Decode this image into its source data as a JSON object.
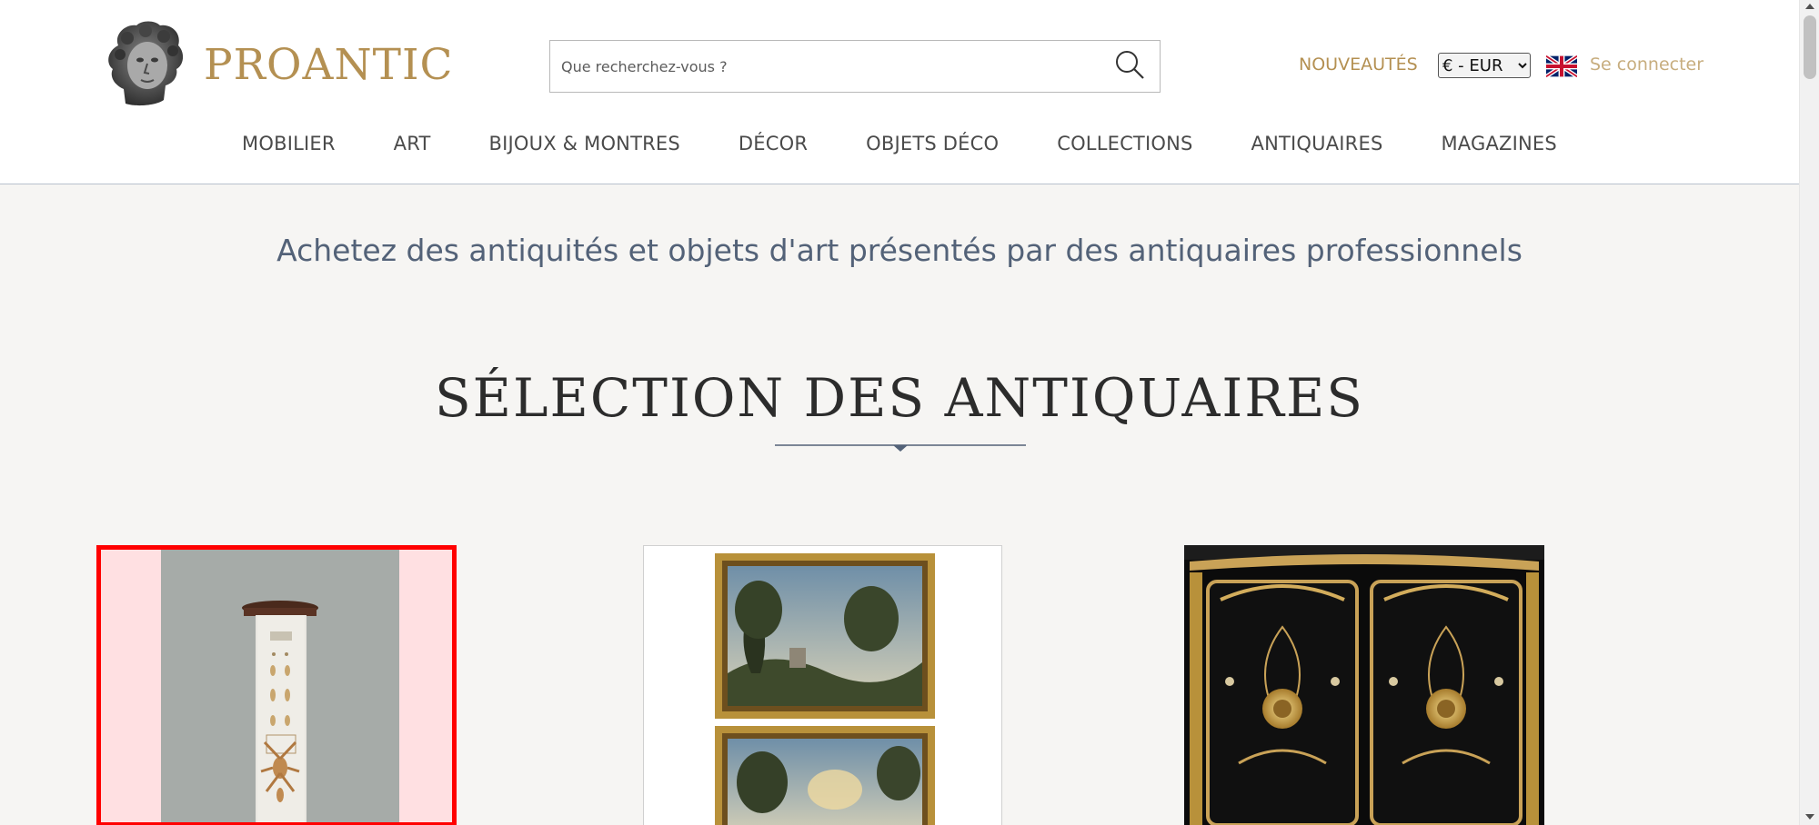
{
  "brand": {
    "name": "PROANTIC",
    "color": "#b49052"
  },
  "search": {
    "placeholder": "Que recherchez-vous ?",
    "icon": "search-icon"
  },
  "header_links": {
    "news": "NOUVEAUTÉS",
    "login": "Se connecter",
    "news_color": "#b49052",
    "login_color": "#c7ad7e"
  },
  "currency": {
    "selected": "€ - EUR"
  },
  "language": {
    "icon": "uk-flag-icon"
  },
  "nav": {
    "items": [
      {
        "label": "MOBILIER"
      },
      {
        "label": "ART"
      },
      {
        "label": "BIJOUX & MONTRES"
      },
      {
        "label": "DÉCOR"
      },
      {
        "label": "OBJETS DÉCO"
      },
      {
        "label": "COLLECTIONS"
      },
      {
        "label": "ANTIQUAIRES"
      },
      {
        "label": "MAGAZINES"
      }
    ]
  },
  "tagline": {
    "text": "Achetez des antiquités et objets d'art présentés par des antiquaires professionnels",
    "color": "#536278"
  },
  "section": {
    "title": "SÉLECTION DES ANTIQUAIRES",
    "divider_color": "#536278"
  },
  "products": [
    {
      "image": "naturalia-vitrine-image",
      "highlight_color": "#ff0000"
    },
    {
      "image": "framed-landscape-paintings-image"
    },
    {
      "image": "boulle-cabinet-image"
    }
  ]
}
